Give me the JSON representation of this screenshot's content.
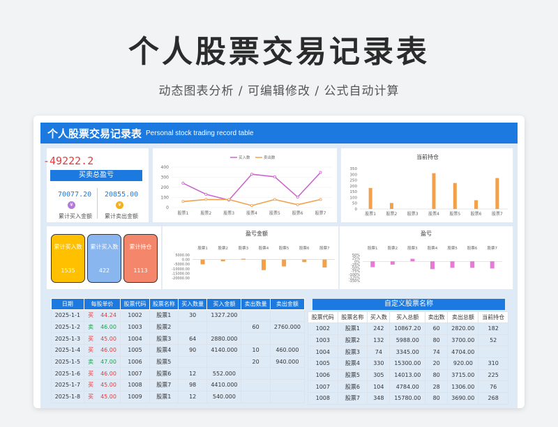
{
  "page": {
    "title": "个人股票交易记录表",
    "subtitle": "动态图表分析 / 可编辑修改 / 公式自动计算"
  },
  "header": {
    "title": "个人股票交易记录表",
    "subtitle": "Personal stock trading record table"
  },
  "summary": {
    "total_pl": "-49222.2",
    "total_pl_label": "买卖总盈亏",
    "buy_total": "70077.20",
    "buy_total_label": "累计买入金额",
    "sell_total": "20855.00",
    "sell_total_label": "累计卖出金额"
  },
  "tiles": [
    {
      "label": "累计买入数",
      "value": "1535",
      "color": "#ffc000"
    },
    {
      "label": "累计买入数",
      "value": "422",
      "color": "#8ab6f0"
    },
    {
      "label": "累计持仓",
      "value": "1113",
      "color": "#f4876b"
    }
  ],
  "colors": {
    "accent": "#1b79e0",
    "buy": "#cc66cc",
    "sell": "#f2a04a",
    "loss_bar": "#f2a04a",
    "pct_bar": "#e77ad6"
  },
  "chart_data": [
    {
      "type": "line",
      "categories": [
        "股票1",
        "股票2",
        "股票3",
        "股票4",
        "股票5",
        "股票6",
        "股票7"
      ],
      "series": [
        {
          "name": "买入数",
          "values": [
            242,
            132,
            74,
            330,
            305,
            104,
            348
          ]
        },
        {
          "name": "卖出数",
          "values": [
            60,
            80,
            80,
            20,
            80,
            28,
            80
          ]
        }
      ],
      "yticks": [
        "400",
        "300",
        "200",
        "100",
        "0"
      ],
      "ylim": [
        0,
        400
      ]
    },
    {
      "type": "bar",
      "title": "当前持仓",
      "categories": [
        "股票1",
        "股票2",
        "股票3",
        "股票4",
        "股票5",
        "股票6",
        "股票7"
      ],
      "values": [
        182,
        52,
        0,
        310,
        225,
        76,
        268
      ],
      "yticks": [
        "350",
        "300",
        "250",
        "200",
        "150",
        "100",
        "50",
        "0"
      ],
      "ylim": [
        0,
        350
      ]
    },
    {
      "type": "bar",
      "title": "盈亏金额",
      "categories": [
        "股票1",
        "股票2",
        "股票3",
        "股票4",
        "股票5",
        "股票6",
        "股票7"
      ],
      "values": [
        -5200,
        -1900,
        900,
        -11500,
        -7500,
        -2800,
        -8600
      ],
      "yticks": [
        "5000.00",
        "0.00",
        "-5000.00",
        "-10000.00",
        "-15000.00",
        "-20000.00"
      ],
      "ylim": [
        -20000,
        5000
      ]
    },
    {
      "type": "bar",
      "title": "盈亏",
      "categories": [
        "股票1",
        "股票2",
        "股票3",
        "股票4",
        "股票5",
        "股票6",
        "股票7"
      ],
      "values": [
        -45,
        -25,
        20,
        -60,
        -50,
        -50,
        -55
      ],
      "yticks": [
        "50%",
        "25%",
        "0%",
        "-25%",
        "-50%",
        "-75%",
        "-100%",
        "-125%",
        "-150%"
      ],
      "ylim": [
        -150,
        50
      ]
    }
  ],
  "trades": {
    "headers": [
      "日期",
      "每股单价",
      "股票代码",
      "股票名称",
      "买入数量",
      "买入金额",
      "卖出数量",
      "卖出金额"
    ],
    "rows": [
      {
        "date": "2025-1-1",
        "side": "买",
        "price": "44.24",
        "code": "1002",
        "name": "股票1",
        "buy_qty": "30",
        "buy_amt": "1327.200",
        "sell_qty": "",
        "sell_amt": ""
      },
      {
        "date": "2025-1-2",
        "side": "卖",
        "price": "46.00",
        "code": "1003",
        "name": "股票2",
        "buy_qty": "",
        "buy_amt": "",
        "sell_qty": "60",
        "sell_amt": "2760.000"
      },
      {
        "date": "2025-1-3",
        "side": "买",
        "price": "45.00",
        "code": "1004",
        "name": "股票3",
        "buy_qty": "64",
        "buy_amt": "2880.000",
        "sell_qty": "",
        "sell_amt": ""
      },
      {
        "date": "2025-1-4",
        "side": "买",
        "price": "46.00",
        "code": "1005",
        "name": "股票4",
        "buy_qty": "90",
        "buy_amt": "4140.000",
        "sell_qty": "10",
        "sell_amt": "460.000"
      },
      {
        "date": "2025-1-5",
        "side": "卖",
        "price": "47.00",
        "code": "1006",
        "name": "股票5",
        "buy_qty": "",
        "buy_amt": "",
        "sell_qty": "20",
        "sell_amt": "940.000"
      },
      {
        "date": "2025-1-6",
        "side": "买",
        "price": "46.00",
        "code": "1007",
        "name": "股票6",
        "buy_qty": "12",
        "buy_amt": "552.000",
        "sell_qty": "",
        "sell_amt": ""
      },
      {
        "date": "2025-1-7",
        "side": "买",
        "price": "45.00",
        "code": "1008",
        "name": "股票7",
        "buy_qty": "98",
        "buy_amt": "4410.000",
        "sell_qty": "",
        "sell_amt": ""
      },
      {
        "date": "2025-1-8",
        "side": "买",
        "price": "45.00",
        "code": "1009",
        "name": "股票1",
        "buy_qty": "12",
        "buy_amt": "540.000",
        "sell_qty": "",
        "sell_amt": ""
      }
    ]
  },
  "custom": {
    "title": "自定义股票名称",
    "headers": [
      "股票代码",
      "股票名称",
      "买入数",
      "买入总额",
      "卖出数",
      "卖出总额",
      "当前持仓"
    ],
    "rows": [
      [
        "1002",
        "股票1",
        "242",
        "10867.20",
        "60",
        "2820.00",
        "182"
      ],
      [
        "1003",
        "股票2",
        "132",
        "5988.00",
        "80",
        "3700.00",
        "52"
      ],
      [
        "1004",
        "股票3",
        "74",
        "3345.00",
        "74",
        "4704.00",
        ""
      ],
      [
        "1005",
        "股票4",
        "330",
        "15300.00",
        "20",
        "920.00",
        "310"
      ],
      [
        "1006",
        "股票5",
        "305",
        "14013.00",
        "80",
        "3715.00",
        "225"
      ],
      [
        "1007",
        "股票6",
        "104",
        "4784.00",
        "28",
        "1306.00",
        "76"
      ],
      [
        "1008",
        "股票7",
        "348",
        "15780.00",
        "80",
        "3690.00",
        "268"
      ]
    ]
  }
}
